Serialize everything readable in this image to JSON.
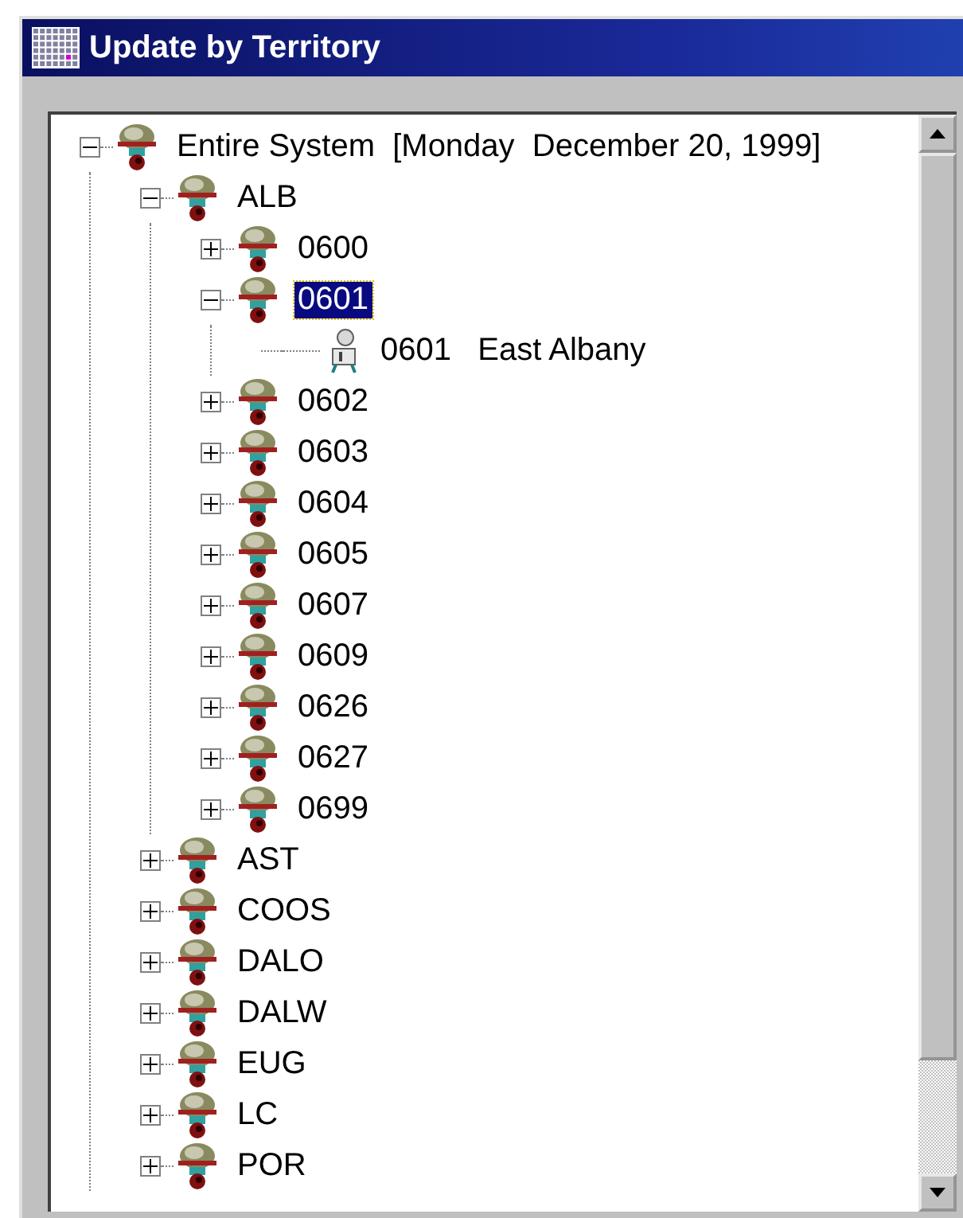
{
  "window": {
    "title": "Update by Territory"
  },
  "tree": [
    {
      "label": "Entire System  [Monday  December 20, 1999]",
      "kind": "group",
      "expanded": true,
      "selected": false,
      "children": [
        {
          "label": "ALB",
          "kind": "group",
          "expanded": true,
          "selected": false,
          "children": [
            {
              "label": "0600",
              "kind": "group",
              "expanded": false,
              "selected": false
            },
            {
              "label": "0601",
              "kind": "group",
              "expanded": true,
              "selected": true,
              "children": [
                {
                  "label": "0601   East Albany",
                  "kind": "leaf",
                  "selected": false
                }
              ]
            },
            {
              "label": "0602",
              "kind": "group",
              "expanded": false,
              "selected": false
            },
            {
              "label": "0603",
              "kind": "group",
              "expanded": false,
              "selected": false
            },
            {
              "label": "0604",
              "kind": "group",
              "expanded": false,
              "selected": false
            },
            {
              "label": "0605",
              "kind": "group",
              "expanded": false,
              "selected": false
            },
            {
              "label": "0607",
              "kind": "group",
              "expanded": false,
              "selected": false
            },
            {
              "label": "0609",
              "kind": "group",
              "expanded": false,
              "selected": false
            },
            {
              "label": "0626",
              "kind": "group",
              "expanded": false,
              "selected": false
            },
            {
              "label": "0627",
              "kind": "group",
              "expanded": false,
              "selected": false
            },
            {
              "label": "0699",
              "kind": "group",
              "expanded": false,
              "selected": false
            }
          ]
        },
        {
          "label": "AST",
          "kind": "group",
          "expanded": false,
          "selected": false
        },
        {
          "label": "COOS",
          "kind": "group",
          "expanded": false,
          "selected": false
        },
        {
          "label": "DALO",
          "kind": "group",
          "expanded": false,
          "selected": false
        },
        {
          "label": "DALW",
          "kind": "group",
          "expanded": false,
          "selected": false
        },
        {
          "label": "EUG",
          "kind": "group",
          "expanded": false,
          "selected": false
        },
        {
          "label": "LC",
          "kind": "group",
          "expanded": false,
          "selected": false
        },
        {
          "label": "POR",
          "kind": "group",
          "expanded": false,
          "selected": false
        }
      ]
    }
  ]
}
